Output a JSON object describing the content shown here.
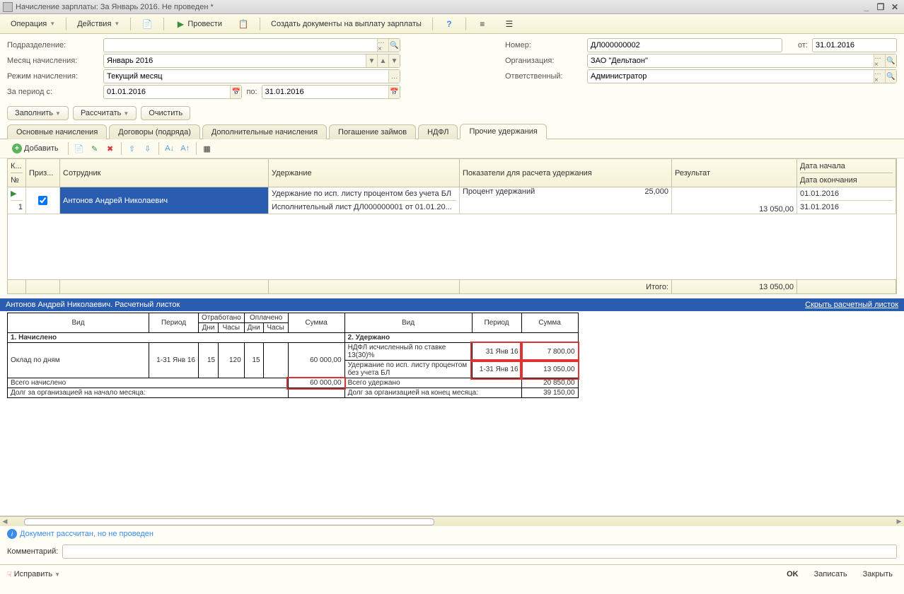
{
  "window": {
    "title": "Начисление зарплаты: За Январь 2016. Не проведен *"
  },
  "toolbar": {
    "operation": "Операция",
    "actions": "Действия",
    "post": "Провести",
    "create_docs": "Создать документы на выплату зарплаты"
  },
  "form": {
    "subdivision_label": "Подразделение:",
    "subdivision": "",
    "month_label": "Месяц начисления:",
    "month": "Январь 2016",
    "mode_label": "Режим начисления:",
    "mode": "Текущий месяц",
    "period_label": "За период с:",
    "period_from": "01.01.2016",
    "period_to_label": "по:",
    "period_to": "31.01.2016",
    "number_label": "Номер:",
    "number": "ДЛ000000002",
    "date_label": "от:",
    "date": "31.01.2016",
    "org_label": "Организация:",
    "org": "ЗАО \"Дельтаон\"",
    "resp_label": "Ответственный:",
    "resp": "Администратор"
  },
  "action_buttons": {
    "fill": "Заполнить",
    "calc": "Рассчитать",
    "clear": "Очистить"
  },
  "tabs": [
    "Основные начисления",
    "Договоры (подряда)",
    "Дополнительные начисления",
    "Погашение займов",
    "НДФЛ",
    "Прочие удержания"
  ],
  "active_tab": 5,
  "grid_toolbar": {
    "add": "Добавить"
  },
  "grid": {
    "headers": {
      "k": "К...",
      "no": "№",
      "sign": "Приз...",
      "employee": "Сотрудник",
      "deduction": "Удержание",
      "indicators": "Показатели для расчета удержания",
      "result": "Результат",
      "date_start": "Дата начала",
      "date_end": "Дата окончания"
    },
    "rows": [
      {
        "no": "1",
        "checked": true,
        "employee": "Антонов Андрей Николаевич",
        "deduction_top": "Удержание по исп. листу процентом без учета БЛ",
        "deduction_bottom": "Исполнительный лист ДЛ000000001 от 01.01.20...",
        "indicator": "Процент удержаний",
        "indicator_val": "25,000",
        "result": "13 050,00",
        "date_start": "01.01.2016",
        "date_end": "31.01.2016"
      }
    ],
    "footer": {
      "total_label": "Итого:",
      "total": "13 050,00"
    }
  },
  "payslip": {
    "header": "Антонов Андрей Николаевич. Расчетный листок",
    "hide_link": "Скрыть расчетный листок",
    "headers": {
      "vid": "Вид",
      "period": "Период",
      "worked": "Отработано",
      "paid": "Оплачено",
      "days": "Дни",
      "hours": "Часы",
      "sum": "Сумма"
    },
    "left": {
      "title": "1. Начислено",
      "row_name": "Оклад по дням",
      "row_period": "1-31 Янв 16",
      "w_days": "15",
      "w_hours": "120",
      "p_days": "15",
      "p_hours": "",
      "row_sum": "60 000,00",
      "total_label": "Всего начислено",
      "total_sum": "60 000,00",
      "debt_label": "Долг за организацией на начало месяца:"
    },
    "right": {
      "title": "2. Удержано",
      "row1_name": "НДФЛ исчисленный по ставке 13(30)%",
      "row1_period": "31 Янв 16",
      "row1_sum": "7 800,00",
      "row2_name": "Удержание по исп. листу процентом без учета БЛ",
      "row2_period": "1-31 Янв 16",
      "row2_sum": "13 050,00",
      "total_label": "Всего удержано",
      "total_sum": "20 850,00",
      "debt_label": "Долг за организацией на конец месяца:",
      "debt_sum": "39 150,00"
    }
  },
  "status": "Документ рассчитан, но не проведен",
  "comment_label": "Комментарий:",
  "bottom": {
    "fix": "Исправить",
    "ok": "OK",
    "save": "Записать",
    "close": "Закрыть"
  }
}
